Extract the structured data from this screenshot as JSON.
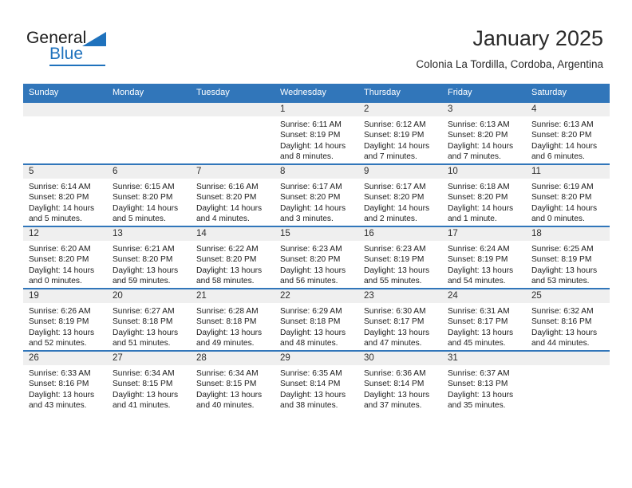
{
  "brand": {
    "name_part1": "General",
    "name_part2": "Blue",
    "logo_icon": "triangle-logo-icon"
  },
  "header": {
    "title": "January 2025",
    "location": "Colonia La Tordilla, Cordoba, Argentina"
  },
  "colors": {
    "header_blue": "#3176ba",
    "brand_blue": "#1f72bd",
    "daynum_bg": "#efefef",
    "text": "#1c1c1c"
  },
  "weekday_headers": [
    "Sunday",
    "Monday",
    "Tuesday",
    "Wednesday",
    "Thursday",
    "Friday",
    "Saturday"
  ],
  "labels": {
    "sunrise_prefix": "Sunrise:",
    "sunset_prefix": "Sunset:",
    "daylight_prefix": "Daylight:"
  },
  "weeks": [
    [
      {
        "day": "",
        "sunrise": "",
        "sunset": "",
        "daylight_l1": "",
        "daylight_l2": "",
        "empty": true
      },
      {
        "day": "",
        "sunrise": "",
        "sunset": "",
        "daylight_l1": "",
        "daylight_l2": "",
        "empty": true
      },
      {
        "day": "",
        "sunrise": "",
        "sunset": "",
        "daylight_l1": "",
        "daylight_l2": "",
        "empty": true
      },
      {
        "day": "1",
        "sunrise": "Sunrise: 6:11 AM",
        "sunset": "Sunset: 8:19 PM",
        "daylight_l1": "Daylight: 14 hours",
        "daylight_l2": "and 8 minutes.",
        "empty": false
      },
      {
        "day": "2",
        "sunrise": "Sunrise: 6:12 AM",
        "sunset": "Sunset: 8:19 PM",
        "daylight_l1": "Daylight: 14 hours",
        "daylight_l2": "and 7 minutes.",
        "empty": false
      },
      {
        "day": "3",
        "sunrise": "Sunrise: 6:13 AM",
        "sunset": "Sunset: 8:20 PM",
        "daylight_l1": "Daylight: 14 hours",
        "daylight_l2": "and 7 minutes.",
        "empty": false
      },
      {
        "day": "4",
        "sunrise": "Sunrise: 6:13 AM",
        "sunset": "Sunset: 8:20 PM",
        "daylight_l1": "Daylight: 14 hours",
        "daylight_l2": "and 6 minutes.",
        "empty": false
      }
    ],
    [
      {
        "day": "5",
        "sunrise": "Sunrise: 6:14 AM",
        "sunset": "Sunset: 8:20 PM",
        "daylight_l1": "Daylight: 14 hours",
        "daylight_l2": "and 5 minutes.",
        "empty": false
      },
      {
        "day": "6",
        "sunrise": "Sunrise: 6:15 AM",
        "sunset": "Sunset: 8:20 PM",
        "daylight_l1": "Daylight: 14 hours",
        "daylight_l2": "and 5 minutes.",
        "empty": false
      },
      {
        "day": "7",
        "sunrise": "Sunrise: 6:16 AM",
        "sunset": "Sunset: 8:20 PM",
        "daylight_l1": "Daylight: 14 hours",
        "daylight_l2": "and 4 minutes.",
        "empty": false
      },
      {
        "day": "8",
        "sunrise": "Sunrise: 6:17 AM",
        "sunset": "Sunset: 8:20 PM",
        "daylight_l1": "Daylight: 14 hours",
        "daylight_l2": "and 3 minutes.",
        "empty": false
      },
      {
        "day": "9",
        "sunrise": "Sunrise: 6:17 AM",
        "sunset": "Sunset: 8:20 PM",
        "daylight_l1": "Daylight: 14 hours",
        "daylight_l2": "and 2 minutes.",
        "empty": false
      },
      {
        "day": "10",
        "sunrise": "Sunrise: 6:18 AM",
        "sunset": "Sunset: 8:20 PM",
        "daylight_l1": "Daylight: 14 hours",
        "daylight_l2": "and 1 minute.",
        "empty": false
      },
      {
        "day": "11",
        "sunrise": "Sunrise: 6:19 AM",
        "sunset": "Sunset: 8:20 PM",
        "daylight_l1": "Daylight: 14 hours",
        "daylight_l2": "and 0 minutes.",
        "empty": false
      }
    ],
    [
      {
        "day": "12",
        "sunrise": "Sunrise: 6:20 AM",
        "sunset": "Sunset: 8:20 PM",
        "daylight_l1": "Daylight: 14 hours",
        "daylight_l2": "and 0 minutes.",
        "empty": false
      },
      {
        "day": "13",
        "sunrise": "Sunrise: 6:21 AM",
        "sunset": "Sunset: 8:20 PM",
        "daylight_l1": "Daylight: 13 hours",
        "daylight_l2": "and 59 minutes.",
        "empty": false
      },
      {
        "day": "14",
        "sunrise": "Sunrise: 6:22 AM",
        "sunset": "Sunset: 8:20 PM",
        "daylight_l1": "Daylight: 13 hours",
        "daylight_l2": "and 58 minutes.",
        "empty": false
      },
      {
        "day": "15",
        "sunrise": "Sunrise: 6:23 AM",
        "sunset": "Sunset: 8:20 PM",
        "daylight_l1": "Daylight: 13 hours",
        "daylight_l2": "and 56 minutes.",
        "empty": false
      },
      {
        "day": "16",
        "sunrise": "Sunrise: 6:23 AM",
        "sunset": "Sunset: 8:19 PM",
        "daylight_l1": "Daylight: 13 hours",
        "daylight_l2": "and 55 minutes.",
        "empty": false
      },
      {
        "day": "17",
        "sunrise": "Sunrise: 6:24 AM",
        "sunset": "Sunset: 8:19 PM",
        "daylight_l1": "Daylight: 13 hours",
        "daylight_l2": "and 54 minutes.",
        "empty": false
      },
      {
        "day": "18",
        "sunrise": "Sunrise: 6:25 AM",
        "sunset": "Sunset: 8:19 PM",
        "daylight_l1": "Daylight: 13 hours",
        "daylight_l2": "and 53 minutes.",
        "empty": false
      }
    ],
    [
      {
        "day": "19",
        "sunrise": "Sunrise: 6:26 AM",
        "sunset": "Sunset: 8:19 PM",
        "daylight_l1": "Daylight: 13 hours",
        "daylight_l2": "and 52 minutes.",
        "empty": false
      },
      {
        "day": "20",
        "sunrise": "Sunrise: 6:27 AM",
        "sunset": "Sunset: 8:18 PM",
        "daylight_l1": "Daylight: 13 hours",
        "daylight_l2": "and 51 minutes.",
        "empty": false
      },
      {
        "day": "21",
        "sunrise": "Sunrise: 6:28 AM",
        "sunset": "Sunset: 8:18 PM",
        "daylight_l1": "Daylight: 13 hours",
        "daylight_l2": "and 49 minutes.",
        "empty": false
      },
      {
        "day": "22",
        "sunrise": "Sunrise: 6:29 AM",
        "sunset": "Sunset: 8:18 PM",
        "daylight_l1": "Daylight: 13 hours",
        "daylight_l2": "and 48 minutes.",
        "empty": false
      },
      {
        "day": "23",
        "sunrise": "Sunrise: 6:30 AM",
        "sunset": "Sunset: 8:17 PM",
        "daylight_l1": "Daylight: 13 hours",
        "daylight_l2": "and 47 minutes.",
        "empty": false
      },
      {
        "day": "24",
        "sunrise": "Sunrise: 6:31 AM",
        "sunset": "Sunset: 8:17 PM",
        "daylight_l1": "Daylight: 13 hours",
        "daylight_l2": "and 45 minutes.",
        "empty": false
      },
      {
        "day": "25",
        "sunrise": "Sunrise: 6:32 AM",
        "sunset": "Sunset: 8:16 PM",
        "daylight_l1": "Daylight: 13 hours",
        "daylight_l2": "and 44 minutes.",
        "empty": false
      }
    ],
    [
      {
        "day": "26",
        "sunrise": "Sunrise: 6:33 AM",
        "sunset": "Sunset: 8:16 PM",
        "daylight_l1": "Daylight: 13 hours",
        "daylight_l2": "and 43 minutes.",
        "empty": false
      },
      {
        "day": "27",
        "sunrise": "Sunrise: 6:34 AM",
        "sunset": "Sunset: 8:15 PM",
        "daylight_l1": "Daylight: 13 hours",
        "daylight_l2": "and 41 minutes.",
        "empty": false
      },
      {
        "day": "28",
        "sunrise": "Sunrise: 6:34 AM",
        "sunset": "Sunset: 8:15 PM",
        "daylight_l1": "Daylight: 13 hours",
        "daylight_l2": "and 40 minutes.",
        "empty": false
      },
      {
        "day": "29",
        "sunrise": "Sunrise: 6:35 AM",
        "sunset": "Sunset: 8:14 PM",
        "daylight_l1": "Daylight: 13 hours",
        "daylight_l2": "and 38 minutes.",
        "empty": false
      },
      {
        "day": "30",
        "sunrise": "Sunrise: 6:36 AM",
        "sunset": "Sunset: 8:14 PM",
        "daylight_l1": "Daylight: 13 hours",
        "daylight_l2": "and 37 minutes.",
        "empty": false
      },
      {
        "day": "31",
        "sunrise": "Sunrise: 6:37 AM",
        "sunset": "Sunset: 8:13 PM",
        "daylight_l1": "Daylight: 13 hours",
        "daylight_l2": "and 35 minutes.",
        "empty": false
      },
      {
        "day": "",
        "sunrise": "",
        "sunset": "",
        "daylight_l1": "",
        "daylight_l2": "",
        "empty": true
      }
    ]
  ]
}
